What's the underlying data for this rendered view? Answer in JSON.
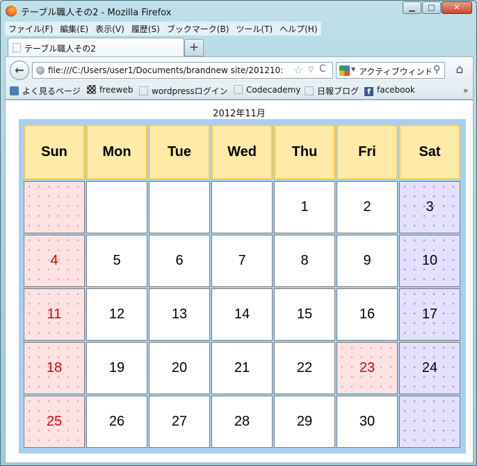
{
  "window": {
    "title": "テーブル職人その2 - Mozilla Firefox",
    "min_glyph": "▁",
    "max_glyph": "□",
    "close_glyph": "✕"
  },
  "menu": [
    "ファイル(F)",
    "編集(E)",
    "表示(V)",
    "履歴(S)",
    "ブックマーク(B)",
    "ツール(T)",
    "ヘルプ(H)"
  ],
  "tab": {
    "label": "テーブル職人その2",
    "new_tab": "+"
  },
  "nav": {
    "back": "←",
    "url": "file:///C:/Users/user1/Documents/brandnew site/201210:",
    "star": "☆",
    "dropdown": "▽",
    "reload": "C",
    "search_text": "アクティブウィンド",
    "search_drop": "▼",
    "search_icon": "⚲",
    "home": "⌂"
  },
  "bookmarks": [
    {
      "label": "よく見るページ",
      "icon": "blue"
    },
    {
      "label": "freeweb",
      "icon": "checker"
    },
    {
      "label": "wordpressログイン",
      "icon": "dotted"
    },
    {
      "label": "Codecademy",
      "icon": "dotted"
    },
    {
      "label": "日報ブログ",
      "icon": "dotted"
    },
    {
      "label": "facebook",
      "icon": "fb"
    }
  ],
  "bookmarks_more": "»",
  "calendar": {
    "caption": "2012年11月",
    "headers": [
      "Sun",
      "Mon",
      "Tue",
      "Wed",
      "Thu",
      "Fri",
      "Sat"
    ],
    "weeks": [
      [
        "",
        "",
        "",
        "",
        "1",
        "2",
        "3"
      ],
      [
        "4",
        "5",
        "6",
        "7",
        "8",
        "9",
        "10"
      ],
      [
        "11",
        "12",
        "13",
        "14",
        "15",
        "16",
        "17"
      ],
      [
        "18",
        "19",
        "20",
        "21",
        "22",
        "23",
        "24"
      ],
      [
        "25",
        "26",
        "27",
        "28",
        "29",
        "30",
        ""
      ]
    ],
    "holidays": [
      "23"
    ],
    "colors": {
      "sunday_text": "#e00000",
      "header_bg": "#ffeaa8",
      "frame_bg": "#a6d0f2",
      "saturday_bg": "#e6e0ff",
      "sunday_bg": "#ffe3e3"
    }
  }
}
